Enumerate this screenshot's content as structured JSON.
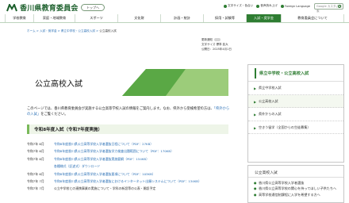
{
  "header": {
    "logo_text": "香川県教育委員会",
    "home_label": "トップへ",
    "tools": [
      "文字サイズ・色合い",
      "音声読み上げ",
      "Foreign Language"
    ],
    "search_placeholder": "Google カスタム検索"
  },
  "nav": {
    "items": [
      {
        "label": "学校教育",
        "active": false
      },
      {
        "label": "家庭・地域教育",
        "active": false
      },
      {
        "label": "スポーツ",
        "active": false
      },
      {
        "label": "文化財",
        "active": false
      },
      {
        "label": "計画・統計",
        "active": false
      },
      {
        "label": "採用・試験等",
        "active": false
      },
      {
        "label": "入試・奨学金",
        "active": true
      },
      {
        "label": "教育委員会について",
        "active": false
      }
    ]
  },
  "breadcrumb": {
    "items": [
      "ホーム",
      "入試・奨学金",
      "県立中学校・公立高校入試"
    ],
    "current": "公立高校入試"
  },
  "page_info": {
    "update_label": "更新通知",
    "font_size_label": "文字サイズ  標準  拡大",
    "updated": "公開日：2025年4月1日"
  },
  "page_title": "公立高校入試",
  "intro": {
    "text_before": "このページでは、香川県教育委員会が実施する公立高等学校入試の情報をご案内します。なお、県外から受検希望の方は、",
    "link": "「県外からの入試」",
    "text_after": "をご覧ください。"
  },
  "section_title": "令和8年度入試（令和7年度実施）",
  "news": [
    {
      "date": "令和7年 6月",
      "text": "令和8年度香川県公立高等学校入学者選抜日程について（PDF：27KB）",
      "link": true
    },
    {
      "date": "令和7年 6月",
      "text": "令和8年度香川県公立高等学校入学者選抜学力検査出題範囲について（PDF：170KB）",
      "link": true
    },
    {
      "date": "令和7年 6月",
      "text": "令和8年度香川県公立高等学校入学者選抜実施要綱（PDF：154KB）",
      "link": true
    },
    {
      "date": "",
      "text": "各種様式（記述式）ダウンロード",
      "link": true
    },
    {
      "date": "令和7年 6月",
      "text": "令和8年度香川県公立高等学校入学者選抜要項について（PDF：103KB）",
      "link": true
    },
    {
      "date": "令和7年 7月",
      "text": "令和8年度香川県公立高等学校入学者選抜におけるインターネット出願システムについて（PDF：134KB）",
      "link": true
    },
    {
      "date": "令和7年 7月",
      "text": "公立中学校との連携事業の実施について・学科の新設等の公表・開設予定",
      "link": false
    }
  ],
  "sidebar": {
    "title": "県立中学校・公立高校入試",
    "items": [
      {
        "label": "県立中学校入試",
        "selected": false
      },
      {
        "label": "公立高校入試",
        "selected": true
      },
      {
        "label": "県外からの入試",
        "selected": false
      },
      {
        "label": "空きう留学（全国からの生徒募集）",
        "selected": false
      }
    ]
  },
  "sidebar2": {
    "title": "公立高校入試",
    "items": [
      "香川県公立高等学校入学者選抜",
      "香川県公立高等学校の関心を持ってほしい子供たちへ",
      "高等学校通信制課程に入学を希望する方へ"
    ]
  },
  "colors": {
    "brand_green": "#2e7d32",
    "banner_green": "#7ab95a",
    "link_blue": "#2a6fb5"
  }
}
